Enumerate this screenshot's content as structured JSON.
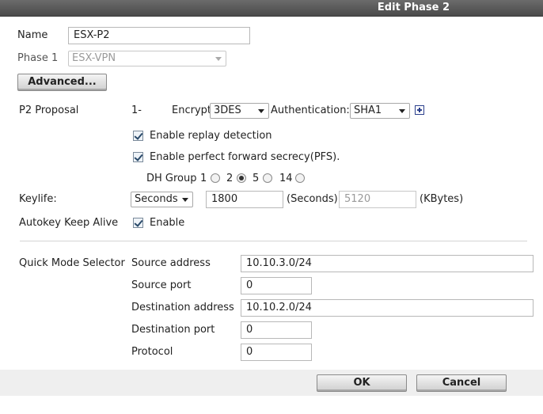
{
  "dialog": {
    "title": "Edit Phase 2"
  },
  "name": {
    "label": "Name",
    "value": "ESX-P2"
  },
  "phase1": {
    "label": "Phase 1",
    "value": "ESX-VPN"
  },
  "advanced_button": "Advanced...",
  "p2_proposal": {
    "label": "P2 Proposal",
    "index": "1-",
    "encryption_label": "Encryption:",
    "encryption_value": "3DES",
    "authentication_label": "Authentication:",
    "authentication_value": "SHA1"
  },
  "replay_detection": {
    "label": "Enable replay detection",
    "checked": true
  },
  "pfs": {
    "label": "Enable perfect forward secrecy(PFS).",
    "checked": true
  },
  "dh_group": {
    "label": "DH Group",
    "options": [
      "1",
      "2",
      "5",
      "14"
    ],
    "selected": "5"
  },
  "keylife": {
    "label": "Keylife:",
    "unit_value": "Seconds",
    "seconds_value": "1800",
    "seconds_label": "(Seconds)",
    "kbytes_value": "5120",
    "kbytes_label": "(KBytes)"
  },
  "autokey": {
    "label": "Autokey Keep Alive",
    "checkbox_label": "Enable",
    "checked": true
  },
  "quick_mode": {
    "label": "Quick Mode Selector",
    "source_address_label": "Source address",
    "source_address_value": "10.10.3.0/24",
    "source_port_label": "Source port",
    "source_port_value": "0",
    "destination_address_label": "Destination address",
    "destination_address_value": "10.10.2.0/24",
    "destination_port_label": "Destination port",
    "destination_port_value": "0",
    "protocol_label": "Protocol",
    "protocol_value": "0"
  },
  "footer": {
    "ok_label": "OK",
    "cancel_label": "Cancel"
  },
  "colors": {
    "titlebar": "#4f4f4f",
    "footer_bg": "#efefef",
    "plus_icon": "#2b3f8c"
  }
}
